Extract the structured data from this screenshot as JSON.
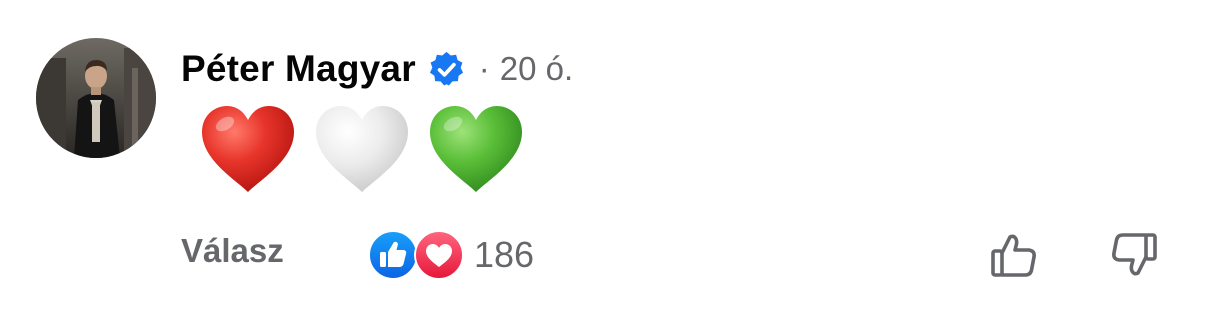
{
  "comment": {
    "author": "Péter Magyar",
    "verified": true,
    "separator": "·",
    "time_ago": "20 ó.",
    "content_emojis": [
      "red-heart",
      "white-heart",
      "green-heart"
    ]
  },
  "actions": {
    "reply_label": "Válasz",
    "reactions": [
      "like",
      "love"
    ],
    "reaction_count": "186"
  },
  "colors": {
    "verified_blue": "#1877f2",
    "like_blue": "#1877f2",
    "love_red": "#f33e58",
    "secondary_text": "#65676b",
    "heart_red": "#e0302a",
    "heart_white": "#e6e6e6",
    "heart_green": "#5ec43d"
  }
}
